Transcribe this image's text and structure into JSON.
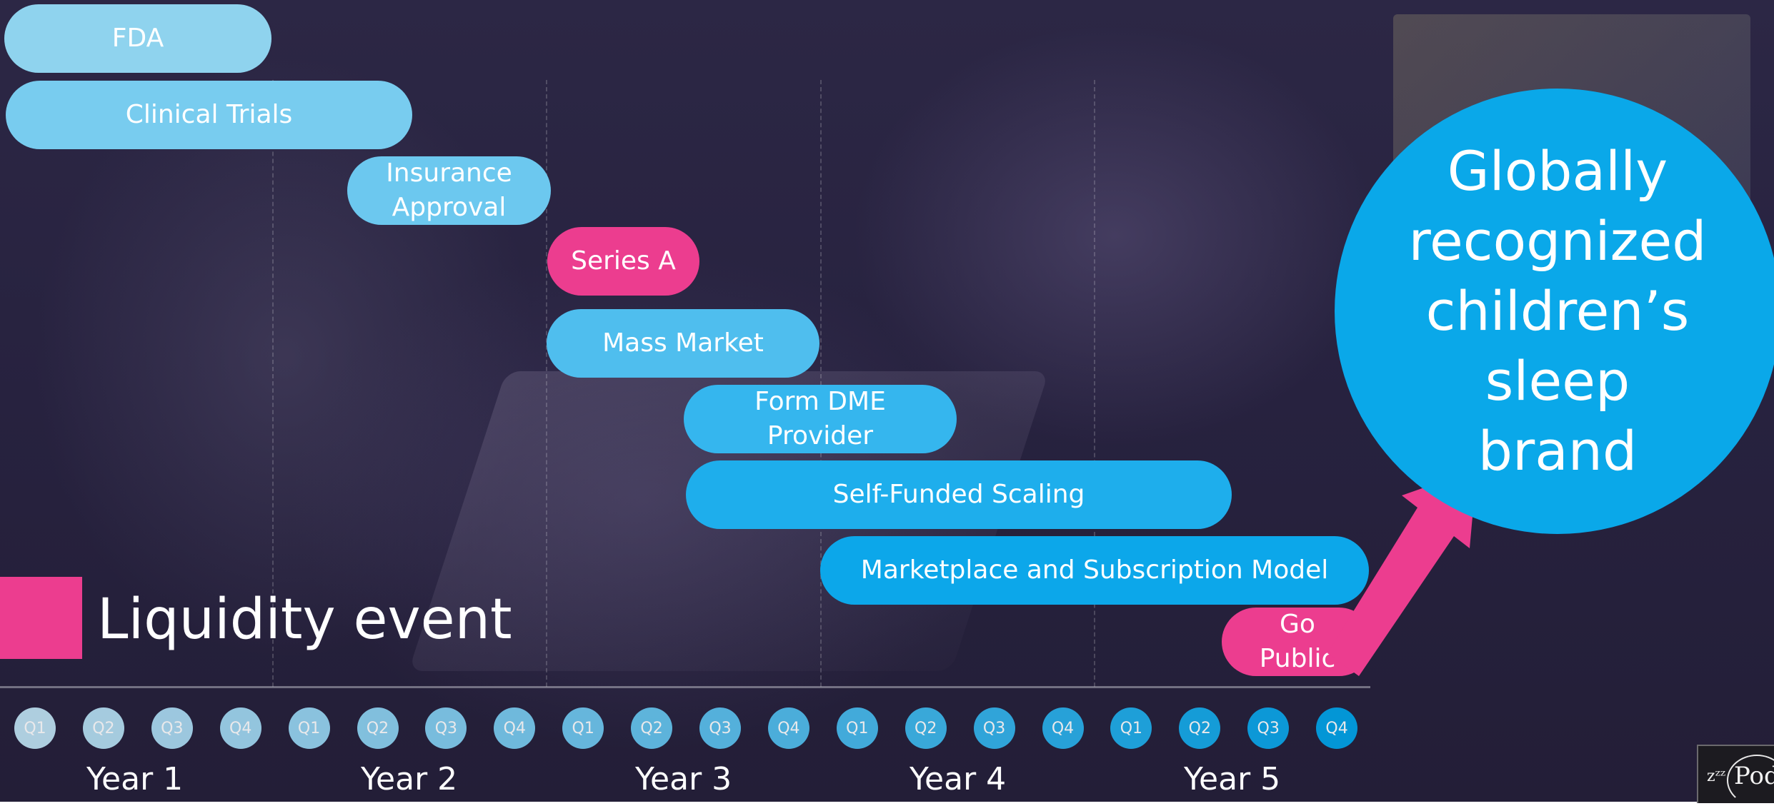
{
  "legend": {
    "label": "Liquidity event",
    "color": "#ec3d8f"
  },
  "milestones": [
    {
      "label": "FDA",
      "color": "#8fd3ee"
    },
    {
      "label": "Clinical Trials",
      "color": "#78ccef"
    },
    {
      "label": "Insurance\nApproval",
      "color": "#6cc8ef"
    },
    {
      "label": "Series A",
      "color": "#ec3d8f"
    },
    {
      "label": "Mass Market",
      "color": "#4fbeee"
    },
    {
      "label": "Form DME\nProvider",
      "color": "#35b6ee"
    },
    {
      "label": "Self-Funded Scaling",
      "color": "#1eaeec"
    },
    {
      "label": "Marketplace and Subscription Model",
      "color": "#0ca7ea"
    },
    {
      "label": "Go\nPublic",
      "color": "#ec3d8f"
    }
  ],
  "quarters": [
    "Q1",
    "Q2",
    "Q3",
    "Q4",
    "Q1",
    "Q2",
    "Q3",
    "Q4",
    "Q1",
    "Q2",
    "Q3",
    "Q4",
    "Q1",
    "Q2",
    "Q3",
    "Q4",
    "Q1",
    "Q2",
    "Q3",
    "Q4"
  ],
  "years": [
    "Year 1",
    "Year 2",
    "Year 3",
    "Year 4",
    "Year 5"
  ],
  "goal": {
    "text": "Globally\nrecognized\nchildren’s\nsleep\nbrand",
    "color": "#0aa8e9"
  },
  "arrow_color": "#ec3d8f",
  "logo": {
    "prefix": "zᶻᶻ",
    "name": "Pods"
  }
}
